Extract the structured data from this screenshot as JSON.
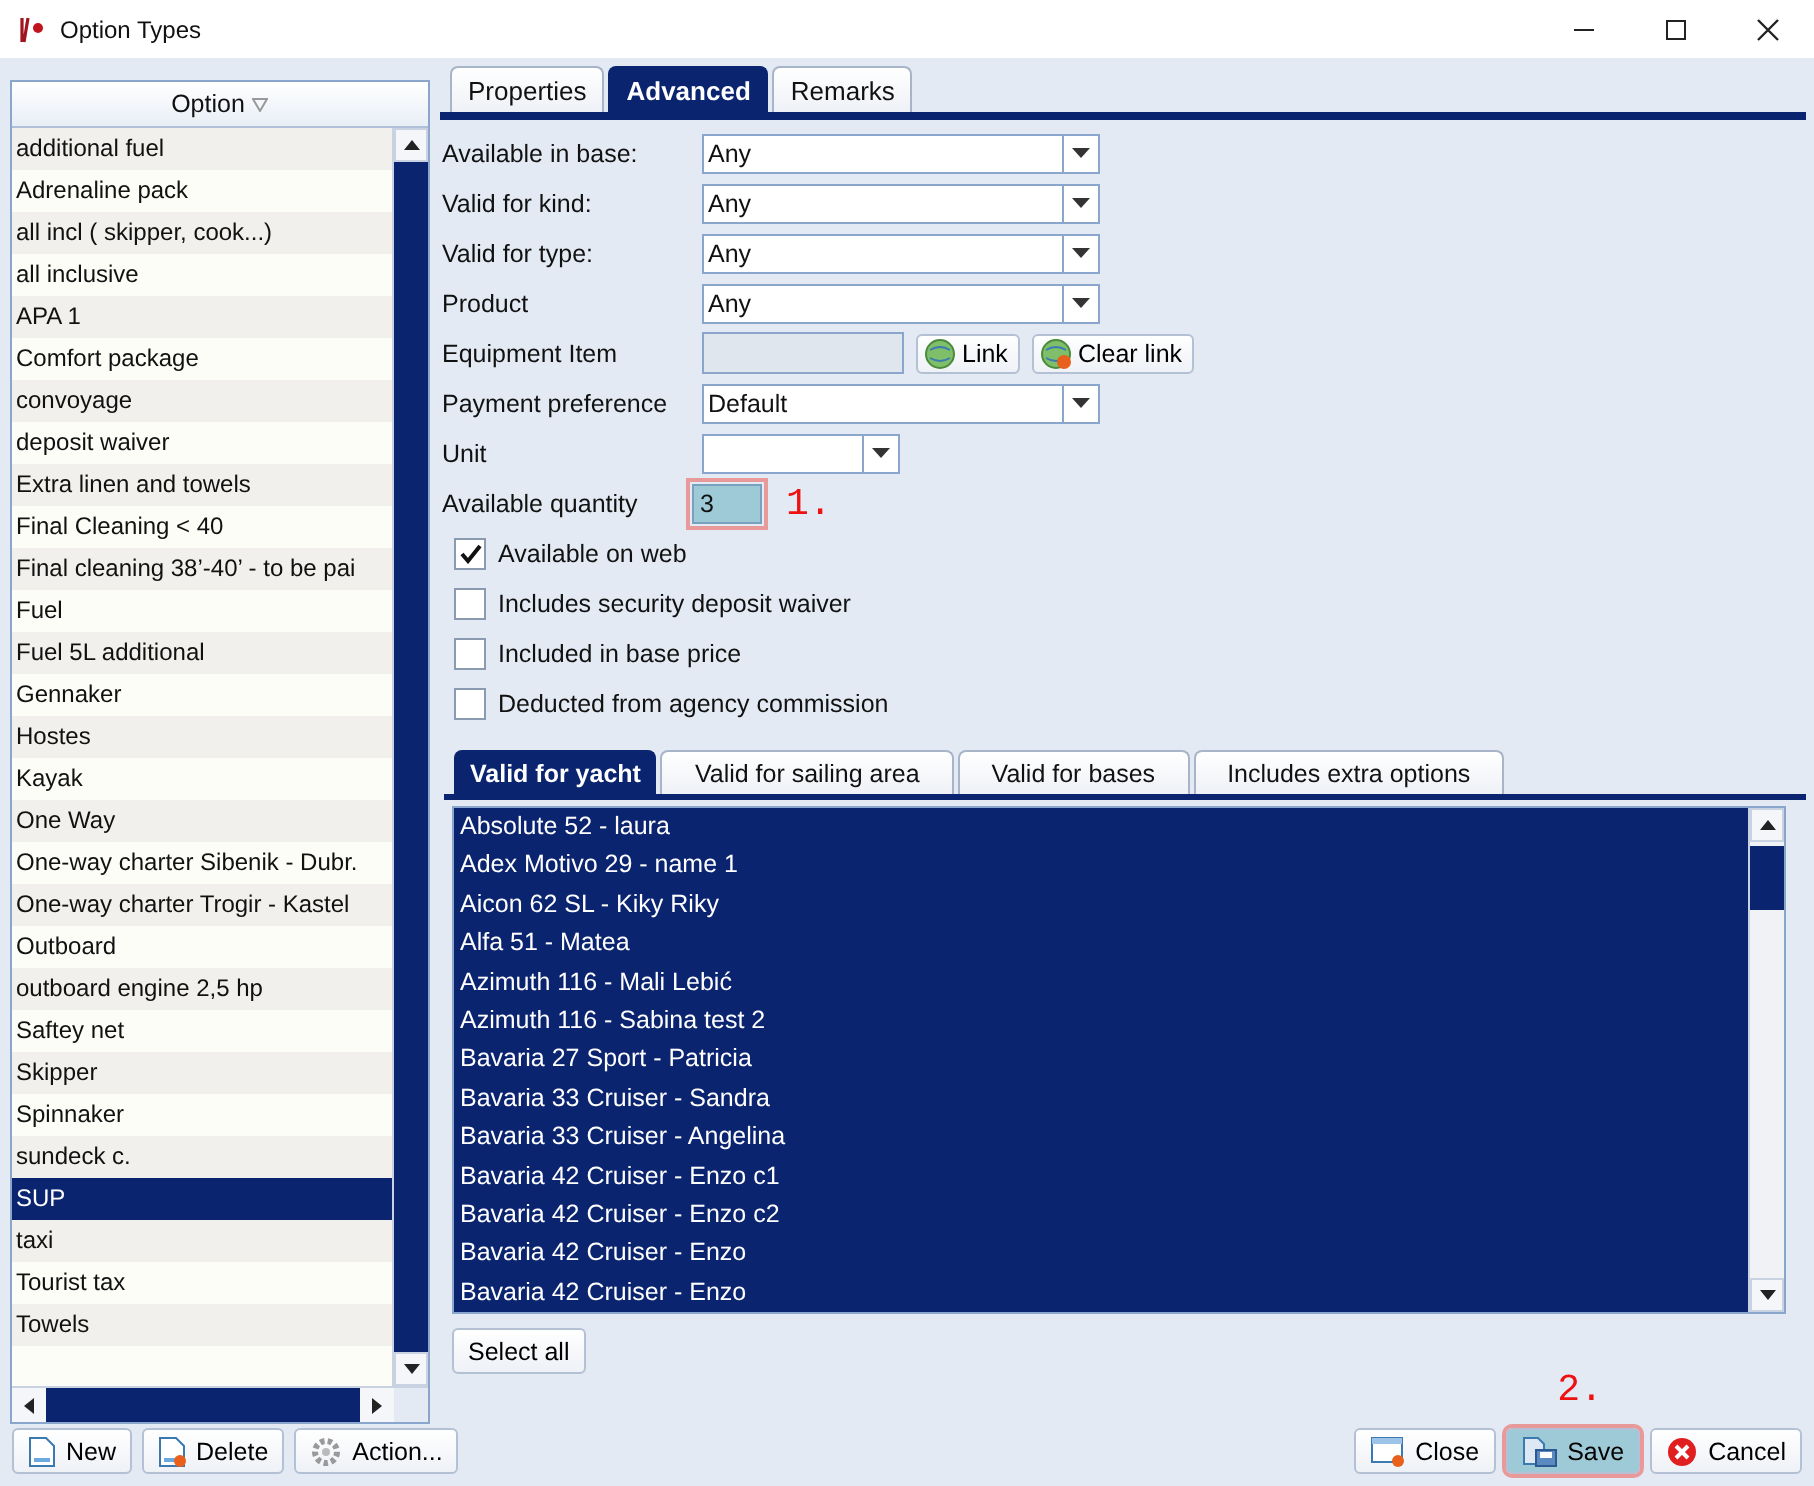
{
  "window": {
    "title": "Option Types"
  },
  "option_list": {
    "column": "Option",
    "items": [
      {
        "label": "additional fuel",
        "selected": false
      },
      {
        "label": "Adrenaline pack",
        "selected": false
      },
      {
        "label": "all incl ( skipper, cook...)",
        "selected": false
      },
      {
        "label": "all inclusive",
        "selected": false
      },
      {
        "label": "APA 1",
        "selected": false
      },
      {
        "label": "Comfort package",
        "selected": false
      },
      {
        "label": "convoyage",
        "selected": false
      },
      {
        "label": "deposit waiver",
        "selected": false
      },
      {
        "label": "Extra linen and towels",
        "selected": false
      },
      {
        "label": "Final Cleaning < 40",
        "selected": false
      },
      {
        "label": "Final cleaning 38’-40’ - to be pai",
        "selected": false
      },
      {
        "label": "Fuel",
        "selected": false
      },
      {
        "label": "Fuel 5L additional",
        "selected": false
      },
      {
        "label": "Gennaker",
        "selected": false
      },
      {
        "label": "Hostes",
        "selected": false
      },
      {
        "label": "Kayak",
        "selected": false
      },
      {
        "label": "One Way",
        "selected": false
      },
      {
        "label": "One-way charter Sibenik - Dubr.",
        "selected": false
      },
      {
        "label": "One-way charter Trogir - Kastel",
        "selected": false
      },
      {
        "label": "Outboard",
        "selected": false
      },
      {
        "label": "outboard engine 2,5 hp",
        "selected": false
      },
      {
        "label": "Saftey net",
        "selected": false
      },
      {
        "label": "Skipper",
        "selected": false
      },
      {
        "label": "Spinnaker",
        "selected": false
      },
      {
        "label": "sundeck c.",
        "selected": false
      },
      {
        "label": "SUP",
        "selected": true
      },
      {
        "label": "taxi",
        "selected": false
      },
      {
        "label": "Tourist tax",
        "selected": false
      },
      {
        "label": "Towels",
        "selected": false
      }
    ]
  },
  "tabs": [
    {
      "label": "Properties",
      "selected": false
    },
    {
      "label": "Advanced",
      "selected": true
    },
    {
      "label": "Remarks",
      "selected": false
    }
  ],
  "form": {
    "rows": [
      {
        "kind": "select",
        "label": "Available in base:",
        "value": "Any"
      },
      {
        "kind": "select",
        "label": "Valid for kind:",
        "value": "Any"
      },
      {
        "kind": "select",
        "label": "Valid for type:",
        "value": "Any"
      },
      {
        "kind": "select",
        "label": "Product",
        "value": "Any"
      },
      {
        "kind": "link",
        "label": "Equipment Item",
        "buttons": [
          "Link",
          "Clear link"
        ]
      },
      {
        "kind": "select",
        "label": "Payment preference",
        "value": "Default"
      },
      {
        "kind": "small-select",
        "label": "Unit"
      },
      {
        "kind": "number",
        "label": "Available quantity",
        "value": "3",
        "annotation": "1."
      }
    ]
  },
  "checkboxes": [
    {
      "label": "Available on web",
      "checked": true
    },
    {
      "label": "Includes security deposit waiver",
      "checked": false
    },
    {
      "label": "Included in base price",
      "checked": false
    },
    {
      "label": "Deducted from agency commission",
      "checked": false
    }
  ],
  "sub_tabs": [
    {
      "label": "Valid for yacht",
      "selected": true
    },
    {
      "label": "Valid for sailing area",
      "selected": false
    },
    {
      "label": "Valid for bases",
      "selected": false
    },
    {
      "label": "Includes extra options",
      "selected": false
    }
  ],
  "yacht_list": {
    "items": [
      {
        "label": "Absolute 52 - laura",
        "selected": true
      },
      {
        "label": "Adex Motivo 29 - name 1",
        "selected": true
      },
      {
        "label": "Aicon 62 SL - Kiky Riky",
        "selected": true
      },
      {
        "label": "Alfa 51 - Matea",
        "selected": true
      },
      {
        "label": "Azimuth 116 - Mali Lebić",
        "selected": true
      },
      {
        "label": "Azimuth 116 - Sabina test 2",
        "selected": true
      },
      {
        "label": "Bavaria 27 Sport - Patricia",
        "selected": true
      },
      {
        "label": "Bavaria 33 Cruiser - Sandra",
        "selected": true
      },
      {
        "label": "Bavaria 33 Cruiser - Angelina",
        "selected": true
      },
      {
        "label": "Bavaria 42 Cruiser - Enzo c1",
        "selected": true
      },
      {
        "label": "Bavaria 42 Cruiser - Enzo c2",
        "selected": true
      },
      {
        "label": "Bavaria 42 Cruiser - Enzo",
        "selected": true
      },
      {
        "label": "Bavaria 42 Cruiser - Enzo",
        "selected": true
      }
    ]
  },
  "select_all": "Select all",
  "buttons_left": [
    {
      "label": "New",
      "kind": "new"
    },
    {
      "label": "Delete",
      "kind": "delete"
    },
    {
      "label": "Action...",
      "kind": "action"
    }
  ],
  "buttons_right": [
    {
      "label": "Close",
      "kind": "close"
    },
    {
      "label": "Save",
      "kind": "save",
      "annotation": "2."
    },
    {
      "label": "Cancel",
      "kind": "cancel"
    }
  ]
}
